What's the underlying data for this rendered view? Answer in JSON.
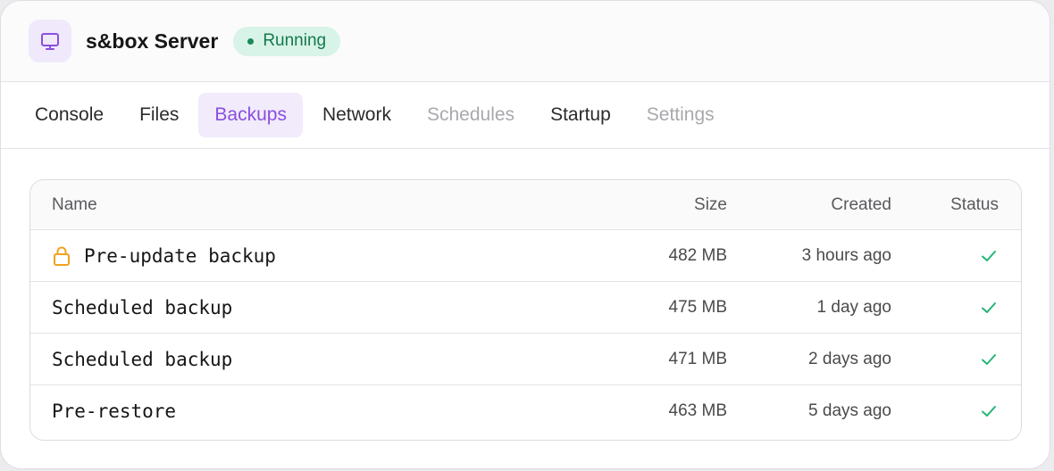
{
  "server": {
    "title": "s&box Server",
    "status_label": "Running",
    "icon": "monitor-icon"
  },
  "tabs": [
    {
      "label": "Console",
      "state": "normal"
    },
    {
      "label": "Files",
      "state": "normal"
    },
    {
      "label": "Backups",
      "state": "active"
    },
    {
      "label": "Network",
      "state": "normal"
    },
    {
      "label": "Schedules",
      "state": "disabled"
    },
    {
      "label": "Startup",
      "state": "normal"
    },
    {
      "label": "Settings",
      "state": "disabled"
    }
  ],
  "table": {
    "headers": {
      "name": "Name",
      "size": "Size",
      "created": "Created",
      "status": "Status"
    },
    "rows": [
      {
        "name": "Pre-update backup",
        "size": "482 MB",
        "created": "3 hours ago",
        "locked": true,
        "status": "success"
      },
      {
        "name": "Scheduled backup",
        "size": "475 MB",
        "created": "1 day ago",
        "locked": false,
        "status": "success"
      },
      {
        "name": "Scheduled backup",
        "size": "471 MB",
        "created": "2 days ago",
        "locked": false,
        "status": "success"
      },
      {
        "name": "Pre-restore",
        "size": "463 MB",
        "created": "5 days ago",
        "locked": false,
        "status": "success"
      }
    ]
  },
  "colors": {
    "accent": "#8a4fdc",
    "running_bg": "#d8f3e7",
    "running_text": "#137a4d",
    "check": "#22b573",
    "lock": "#f0a21f"
  }
}
